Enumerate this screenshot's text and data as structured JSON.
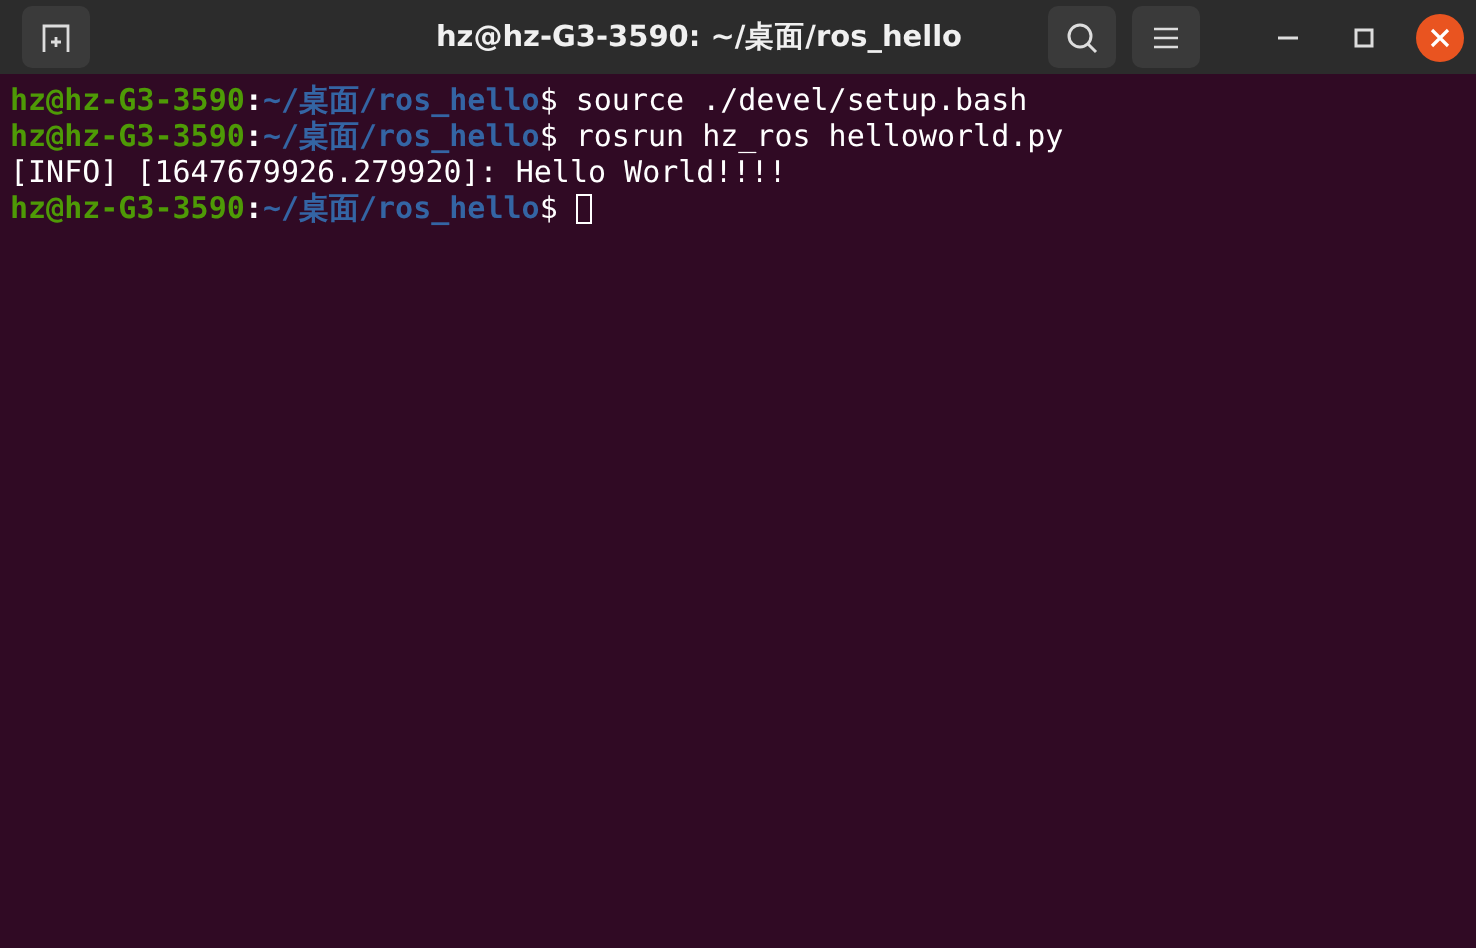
{
  "window": {
    "title": "hz@hz-G3-3590: ~/桌面/ros_hello"
  },
  "lines": [
    {
      "kind": "prompt",
      "user_host": "hz@hz-G3-3590",
      "separator": ":",
      "path": "~/桌面/ros_hello",
      "symbol": "$",
      "command": "source ./devel/setup.bash"
    },
    {
      "kind": "prompt",
      "user_host": "hz@hz-G3-3590",
      "separator": ":",
      "path": "~/桌面/ros_hello",
      "symbol": "$",
      "command": "rosrun hz_ros helloworld.py"
    },
    {
      "kind": "output",
      "text": "[INFO] [1647679926.279920]: Hello World!!!!"
    },
    {
      "kind": "prompt",
      "user_host": "hz@hz-G3-3590",
      "separator": ":",
      "path": "~/桌面/ros_hello",
      "symbol": "$",
      "cursor": true
    }
  ]
}
